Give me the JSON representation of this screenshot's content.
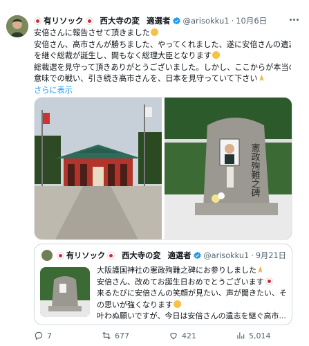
{
  "author": {
    "name_prefix": "有リソック",
    "name_middle": "西大寺の変",
    "name_suffix": "適選者",
    "handle": "@arisokku1",
    "separator": "·",
    "date": "10月6日"
  },
  "tweet": {
    "lines": [
      "安倍さんに報告させて頂きました",
      "安倍さん、高市さんが勝ちました、やってくれました、遂に安倍さんの遺志",
      "を継ぐ総裁が誕生し、間もなく総理大臣となります",
      "総裁選を見守って頂きありがとうございました。しかし、ここからが本当の",
      "意味での戦い、引き続き高市さんを、日本を見守っていて下さい"
    ],
    "show_more": "さらに表示"
  },
  "media": {
    "monument_text": "憲政殉難之碑"
  },
  "quote": {
    "name_prefix": "有リソック",
    "name_middle": "西大寺の変",
    "name_suffix": "適選者",
    "handle": "@arisokku1",
    "separator": "·",
    "date": "9月21日",
    "lines": [
      "大阪護国神社の憲政殉難之碑にお参りしました",
      "安倍さん、改めてお誕生日おめでとうございます",
      "来るたびに安倍さんの笑顔が見たい、声が聞きたい、そ",
      "の思いが強くなります",
      "叶わぬ願いですが、今日は安倍さんの遺志を継ぐ高市..."
    ]
  },
  "actions": {
    "replies": "7",
    "retweets": "677",
    "likes": "421",
    "views": "5,014"
  },
  "colors": {
    "accent": "#1d9bf0",
    "verified": "#1d9bf0",
    "text_secondary": "#536471"
  }
}
